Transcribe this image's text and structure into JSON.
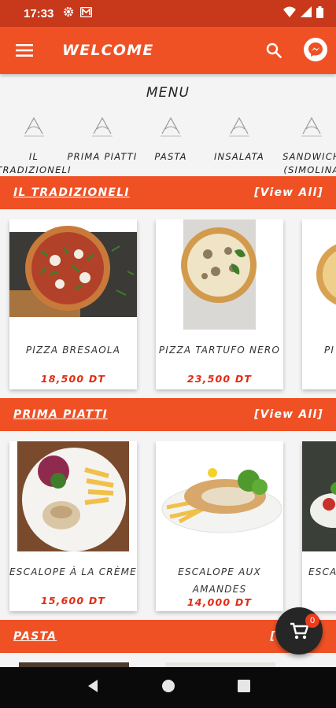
{
  "status": {
    "time": "17:33"
  },
  "appbar": {
    "title": "WELCOME"
  },
  "menu_title": "MENU",
  "categories": [
    {
      "label": "IL TRADIZIONELI"
    },
    {
      "label": "PRIMA PIATTI"
    },
    {
      "label": "PASTA"
    },
    {
      "label": "INSALATA"
    },
    {
      "label": "SANDWICH (SIMOLINA"
    }
  ],
  "sections": [
    {
      "title": "IL TRADIZIONELI",
      "view_all": "[View All]",
      "items": [
        {
          "name": "PIZZA BRESAOLA",
          "price": "18,500 DT"
        },
        {
          "name": "PIZZA TARTUFO NERO",
          "price": "23,500 DT"
        },
        {
          "name": "PI",
          "price": ""
        }
      ]
    },
    {
      "title": "PRIMA PIATTI",
      "view_all": "[View All]",
      "items": [
        {
          "name": "ESCALOPE À LA CRÈME",
          "price": "15,600 DT"
        },
        {
          "name": "ESCALOPE AUX AMANDES",
          "price": "14,000 DT"
        },
        {
          "name": "ESCA",
          "price": ""
        }
      ]
    },
    {
      "title": "PASTA",
      "view_all": "[",
      "items": []
    }
  ],
  "cart": {
    "count": "0"
  },
  "colors": {
    "primary": "#ef5125",
    "status": "#c8391b",
    "price": "#e32b12"
  },
  "icons": [
    "hamburger-icon",
    "search-icon",
    "messenger-icon",
    "cart-icon",
    "gear-icon",
    "m-icon",
    "wifi-icon",
    "signal-icon",
    "battery-icon",
    "back-icon",
    "home-icon",
    "recents-icon"
  ]
}
